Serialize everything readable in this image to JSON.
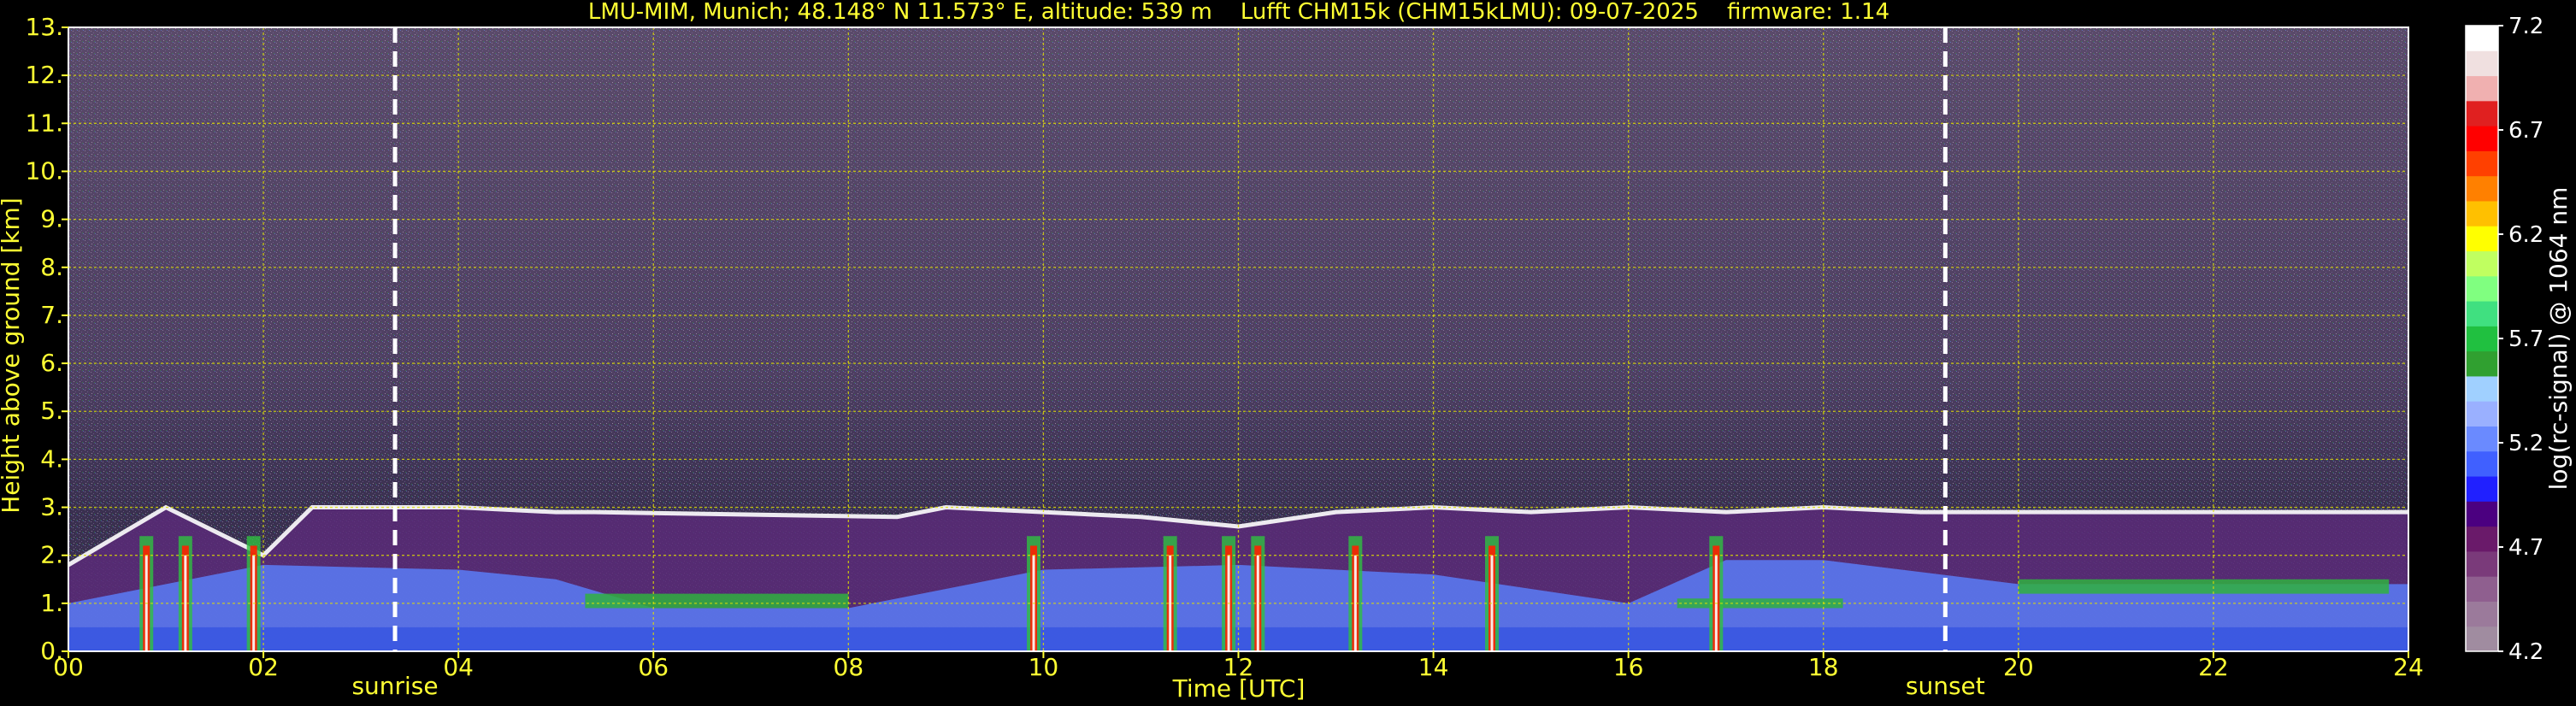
{
  "chart_data": {
    "type": "heatmap",
    "title": "LMU-MIM, Munich; 48.148° N 11.573° E, altitude: 539 m    Lufft CHM15k (CHM15kLMU): 09-07-2025    firmware: 1.14",
    "xlabel": "Time [UTC]",
    "ylabel": "Height above ground [km]",
    "xlim": [
      0,
      24
    ],
    "ylim": [
      0,
      13
    ],
    "x_ticks": [
      "00",
      "02",
      "04",
      "06",
      "08",
      "10",
      "12",
      "14",
      "16",
      "18",
      "20",
      "22",
      "24"
    ],
    "x_tick_values": [
      0,
      2,
      4,
      6,
      8,
      10,
      12,
      14,
      16,
      18,
      20,
      22,
      24
    ],
    "y_ticks": [
      "0.",
      "1.",
      "2.",
      "3.",
      "4.",
      "5.",
      "6.",
      "7.",
      "8.",
      "9.",
      "10.",
      "11.",
      "12.",
      "13."
    ],
    "y_tick_values": [
      0,
      1,
      2,
      3,
      4,
      5,
      6,
      7,
      8,
      9,
      10,
      11,
      12,
      13
    ],
    "grid": true,
    "colorbar": {
      "label": "log(rc-signal) @ 1064 nm",
      "range": [
        4.2,
        7.2
      ],
      "ticks": [
        "4.2",
        "4.7",
        "5.2",
        "5.7",
        "6.2",
        "6.7",
        "7.2"
      ],
      "tick_values": [
        4.2,
        4.7,
        5.2,
        5.7,
        6.2,
        6.7,
        7.2
      ],
      "colors": [
        "#a08ca0",
        "#9b7a9b",
        "#8f5f8f",
        "#7a3a7a",
        "#6a1a6a",
        "#4b0080",
        "#2020ff",
        "#4060ff",
        "#6a8aff",
        "#9ab0ff",
        "#a0d0ff",
        "#30a030",
        "#20c040",
        "#40e080",
        "#80ff80",
        "#c0ff60",
        "#ffff00",
        "#ffc000",
        "#ff8000",
        "#ff4000",
        "#ff0000",
        "#e02020",
        "#f0b0b0",
        "#f0e0e0",
        "#ffffff"
      ]
    },
    "annotations": [
      {
        "text": "sunrise",
        "x": 3.35
      },
      {
        "text": "sunset",
        "x": 19.25
      }
    ],
    "aerosol_layer_top_km": [
      [
        0,
        1.8
      ],
      [
        1,
        3.0
      ],
      [
        2,
        2.0
      ],
      [
        2.5,
        3.0
      ],
      [
        3,
        3.0
      ],
      [
        4,
        3.0
      ],
      [
        5,
        2.9
      ],
      [
        5.4,
        2.9
      ],
      [
        8.5,
        2.8
      ],
      [
        9,
        3.0
      ],
      [
        10,
        2.9
      ],
      [
        11,
        2.8
      ],
      [
        12,
        2.6
      ],
      [
        13,
        2.9
      ],
      [
        14,
        3.0
      ],
      [
        15,
        2.9
      ],
      [
        16,
        3.0
      ],
      [
        17,
        2.9
      ],
      [
        18,
        3.0
      ],
      [
        19,
        2.9
      ],
      [
        20,
        2.9
      ],
      [
        21,
        2.9
      ],
      [
        22,
        2.9
      ],
      [
        23,
        2.9
      ],
      [
        24,
        2.9
      ]
    ],
    "boundary_layer_top_km": [
      [
        0,
        1.0
      ],
      [
        2,
        1.8
      ],
      [
        4,
        1.7
      ],
      [
        5,
        1.5
      ],
      [
        6,
        0.9
      ],
      [
        8,
        0.9
      ],
      [
        10,
        1.7
      ],
      [
        12,
        1.8
      ],
      [
        14,
        1.6
      ],
      [
        16,
        1.0
      ],
      [
        17,
        1.9
      ],
      [
        18,
        1.9
      ],
      [
        20,
        1.4
      ],
      [
        22,
        1.4
      ],
      [
        24,
        1.4
      ]
    ]
  }
}
